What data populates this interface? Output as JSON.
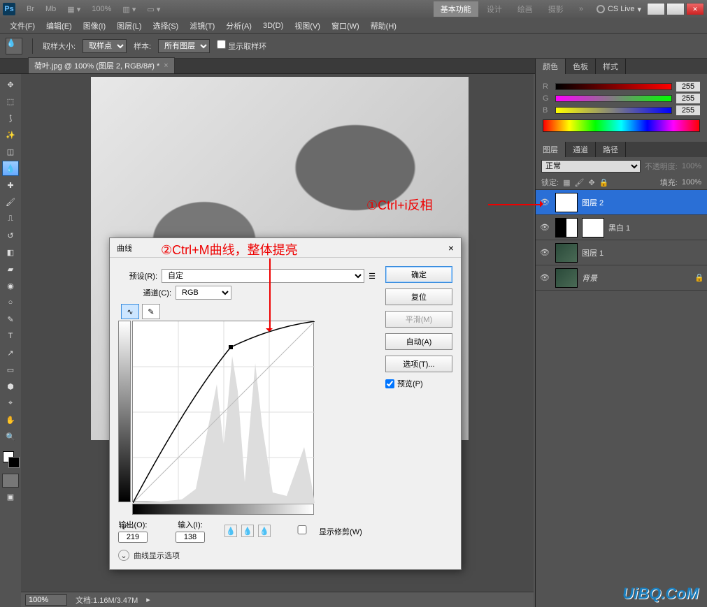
{
  "titlebar": {
    "ps": "Ps",
    "br": "Br",
    "mb": "Mb",
    "zoom": "100%",
    "workspace_active": "基本功能",
    "workspaces": [
      "设计",
      "绘画",
      "摄影"
    ],
    "cslive": "CS Live"
  },
  "menus": [
    "文件(F)",
    "编辑(E)",
    "图像(I)",
    "图层(L)",
    "选择(S)",
    "滤镜(T)",
    "分析(A)",
    "3D(D)",
    "视图(V)",
    "窗口(W)",
    "帮助(H)"
  ],
  "options": {
    "sample_size_label": "取样大小:",
    "sample_size_value": "取样点",
    "sample_label": "样本:",
    "sample_value": "所有图层",
    "show_ring": "显示取样环"
  },
  "doc_tab": "荷叶.jpg @ 100% (图层 2, RGB/8#) *",
  "status": {
    "zoom": "100%",
    "doc": "文档:1.16M/3.47M"
  },
  "panels": {
    "color_tabs": [
      "颜色",
      "色板",
      "样式"
    ],
    "rgb": {
      "R": "255",
      "G": "255",
      "B": "255"
    },
    "layer_tabs": [
      "图层",
      "通道",
      "路径"
    ],
    "blend": "正常",
    "opacity_label": "不透明度:",
    "opacity": "100%",
    "lock_label": "锁定:",
    "fill_label": "填充:",
    "fill": "100%",
    "layers": [
      {
        "name": "图层 2",
        "sel": true,
        "thumb": "mask"
      },
      {
        "name": "黑白 1",
        "thumb": "bw",
        "adj": true
      },
      {
        "name": "图层 1",
        "thumb": "img"
      },
      {
        "name": "背景",
        "thumb": "img",
        "locked": true,
        "italic": true
      }
    ]
  },
  "curves": {
    "title": "曲线",
    "preset_label": "预设(R):",
    "preset": "自定",
    "channel_label": "通道(C):",
    "channel": "RGB",
    "output_label": "输出(O):",
    "output": "219",
    "input_label": "输入(I):",
    "input": "138",
    "show_clip": "显示修剪(W)",
    "disp_options": "曲线显示选项",
    "ok": "确定",
    "cancel": "复位",
    "smooth": "平滑(M)",
    "auto": "自动(A)",
    "options": "选项(T)...",
    "preview": "预览(P)"
  },
  "annotations": {
    "a1": "①Ctrl+i反相",
    "a2": "②Ctrl+M曲线，整体提亮"
  },
  "watermark": "UiBQ.CoM",
  "chart_data": {
    "type": "line",
    "title": "Curves adjustment",
    "xlabel": "Input",
    "ylabel": "Output",
    "xlim": [
      0,
      255
    ],
    "ylim": [
      0,
      255
    ],
    "series": [
      {
        "name": "curve",
        "x": [
          0,
          64,
          138,
          192,
          255
        ],
        "y": [
          0,
          130,
          219,
          246,
          255
        ]
      },
      {
        "name": "identity",
        "x": [
          0,
          255
        ],
        "y": [
          0,
          255
        ]
      }
    ],
    "control_point": {
      "input": 138,
      "output": 219
    }
  }
}
